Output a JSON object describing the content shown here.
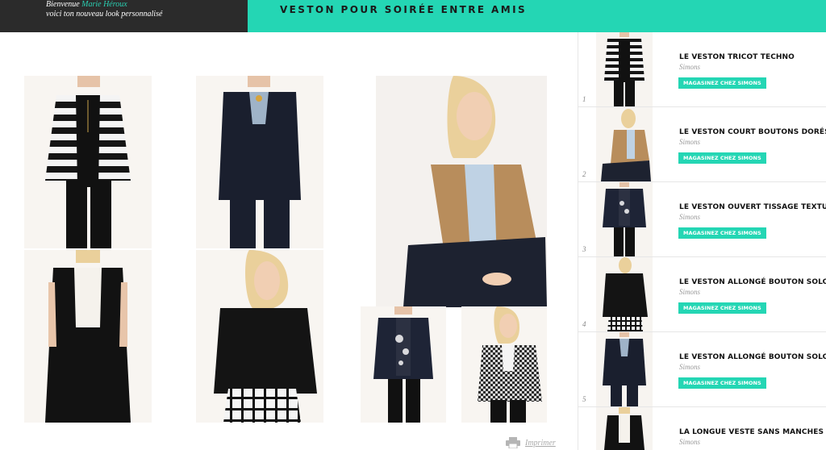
{
  "header": {
    "welcome_prefix": "Bienvenue",
    "user_name": "Marie Héroux",
    "subtitle": "voici ton nouveau look personnalisé",
    "title": "VESTON POUR SOIRÉE ENTRE AMIS"
  },
  "colors": {
    "accent": "#24d6b4",
    "header_dark": "#2b2b2b"
  },
  "look_images": [
    "striped-blazer-look",
    "navy-blazer-pants-look",
    "camel-blazer-model-seated",
    "sleeveless-black-vest-look",
    "black-blazer-check-skirt-look",
    "embroidered-navy-jacket-look",
    "houndstooth-blazer-look"
  ],
  "print": {
    "label": "Imprimer",
    "icon": "printer-icon"
  },
  "products": [
    {
      "number": "1",
      "name": "LE VESTON TRICOT TECHNO",
      "brand": "Simons",
      "button": "MAGASINEZ CHEZ SIMONS"
    },
    {
      "number": "2",
      "name": "LE VESTON COURT BOUTONS DORÉS",
      "brand": "Simons",
      "button": "MAGASINEZ CHEZ SIMONS"
    },
    {
      "number": "3",
      "name": "LE VESTON OUVERT TISSAGE TEXTURÉ",
      "brand": "Simons",
      "button": "MAGASINEZ CHEZ SIMONS"
    },
    {
      "number": "4",
      "name": "LE VESTON ALLONGÉ BOUTON SOLO",
      "brand": "Simons",
      "button": "MAGASINEZ CHEZ SIMONS"
    },
    {
      "number": "5",
      "name": "LE VESTON ALLONGÉ BOUTON SOLO",
      "brand": "Simons",
      "button": "MAGASINEZ CHEZ SIMONS"
    },
    {
      "number": "",
      "name": "LA LONGUE VESTE SANS MANCHES",
      "brand": "Simons",
      "button": ""
    }
  ]
}
